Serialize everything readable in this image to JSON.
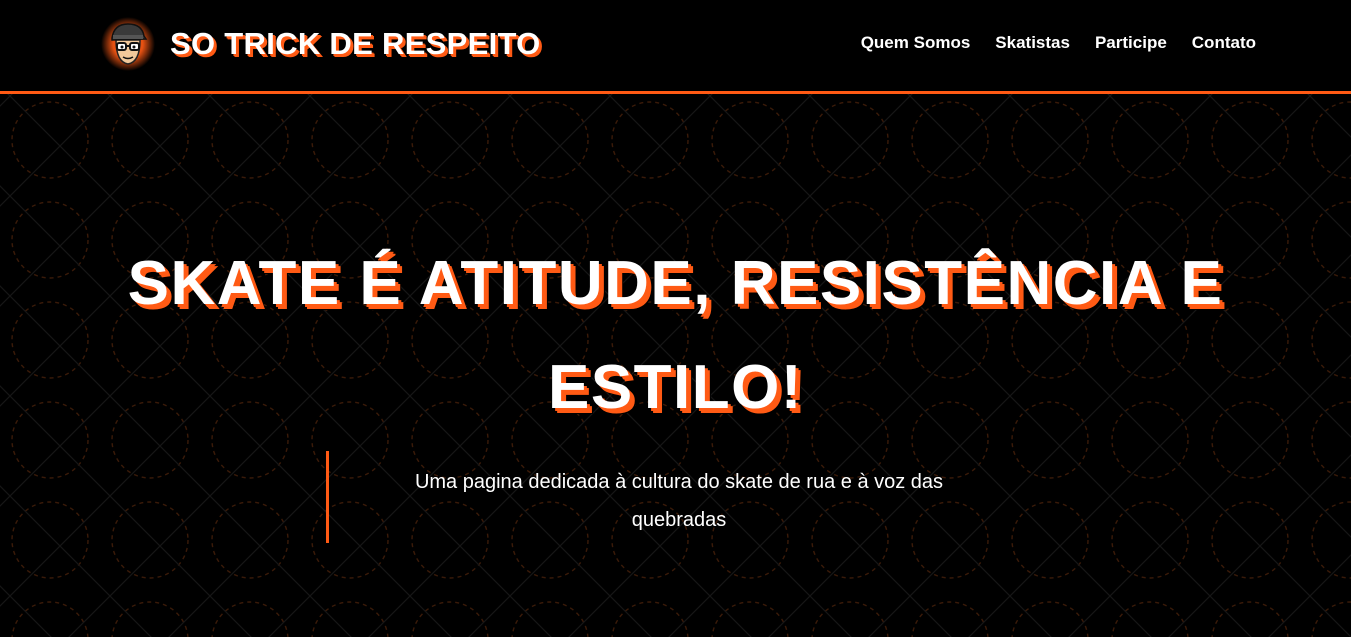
{
  "header": {
    "brand_title": "SO TRICK DE RESPEITO",
    "logo_icon": "skater-avatar-icon",
    "nav": [
      {
        "label": "Quem Somos"
      },
      {
        "label": "Skatistas"
      },
      {
        "label": "Participe"
      },
      {
        "label": "Contato"
      }
    ]
  },
  "hero": {
    "title_line1": "SKATE É ATITUDE, RESISTÊNCIA E",
    "title_line2": "ESTILO!",
    "subtitle": "Uma pagina dedicada à cultura do skate de rua e à voz das quebradas"
  },
  "colors": {
    "background": "#000000",
    "accent": "#ff5a14",
    "text": "#ffffff"
  }
}
